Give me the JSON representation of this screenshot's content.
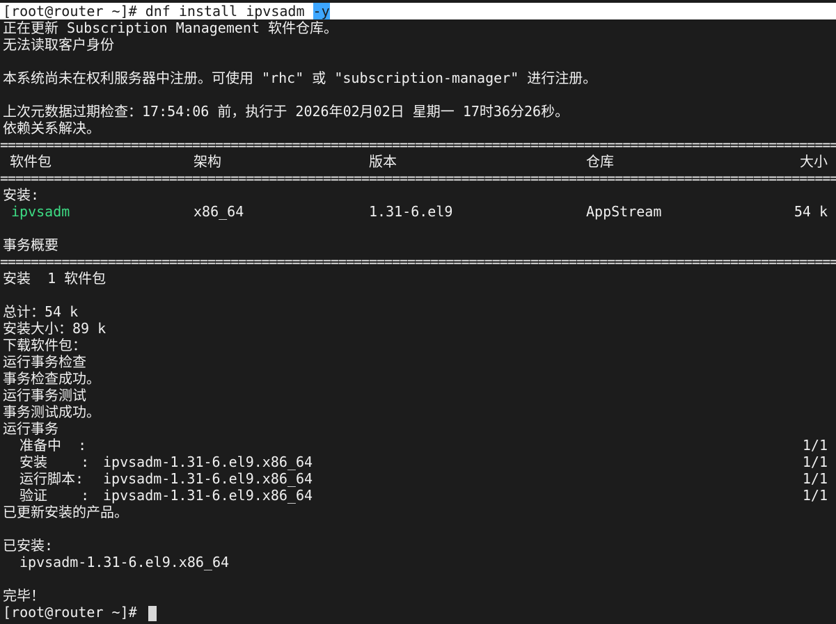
{
  "prompt_prefix": "[root@router ~]# ",
  "command_main": "dnf install ipvsadm ",
  "command_flag": "-y",
  "lines_top": [
    "正在更新 Subscription Management 软件仓库。",
    "无法读取客户身份",
    "",
    "本系统尚未在权利服务器中注册。可使用 \"rhc\" 或 \"subscription-manager\" 进行注册。",
    "",
    "上次元数据过期检查：17:54:06 前，执行于 2026年02月02日 星期一 17时36分26秒。",
    "依赖关系解决。"
  ],
  "separator": "==================================================================================================================================================================================================",
  "table": {
    "headers": [
      "软件包",
      "架构",
      "版本",
      "仓库",
      "大小"
    ],
    "section_label": "安装:",
    "row": {
      "package": "ipvsadm",
      "arch": "x86_64",
      "version": "1.31-6.el9",
      "repo": "AppStream",
      "size": "54 k"
    }
  },
  "summary_title": "事务概要",
  "summary_install": "安装  1 软件包",
  "lines_mid": [
    "总计：54 k",
    "安装大小：89 k",
    "下载软件包：",
    "运行事务检查",
    "事务检查成功。",
    "运行事务测试",
    "事务测试成功。",
    "运行事务"
  ],
  "steps": [
    {
      "label": "准备中  :",
      "detail": "",
      "progress": "1/1"
    },
    {
      "label": "安装    :",
      "detail": "ipvsadm-1.31-6.el9.x86_64",
      "progress": "1/1"
    },
    {
      "label": "运行脚本:",
      "detail": "ipvsadm-1.31-6.el9.x86_64",
      "progress": "1/1"
    },
    {
      "label": "验证    :",
      "detail": "ipvsadm-1.31-6.el9.x86_64",
      "progress": "1/1"
    }
  ],
  "updated_line": "已更新安装的产品。",
  "installed_title": "已安装:",
  "installed_pkg": "ipvsadm-1.31-6.el9.x86_64",
  "done": "完毕！",
  "final_prompt": "[root@router ~]# "
}
